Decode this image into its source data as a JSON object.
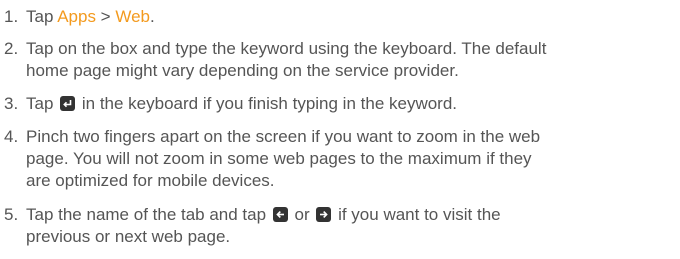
{
  "steps": [
    {
      "num": "1.",
      "prefix": "Tap ",
      "apps": "Apps",
      "sep": " > ",
      "web": "Web",
      "suffix": "."
    },
    {
      "num": "2.",
      "line1": "Tap on the box and type the keyword using the keyboard. The default",
      "line2": "home page might vary depending on the service provider."
    },
    {
      "num": "3.",
      "before": "Tap ",
      "icon": "enter-key-icon",
      "after": " in the keyboard if you finish typing in the keyword."
    },
    {
      "num": "4.",
      "line1": "Pinch two fingers apart on the screen if you want to zoom in the web",
      "line2": "page. You will not zoom in some web pages to the maximum if they",
      "line3": "are optimized for mobile devices."
    },
    {
      "num": "5.",
      "before": "Tap the name of the tab and tap ",
      "icon_back": "back-arrow-icon",
      "middle": " or ",
      "icon_forward": "forward-arrow-icon",
      "after": " if you want to visit the",
      "line2": "previous or next web page."
    }
  ],
  "colors": {
    "text": "#555555",
    "accent": "#f39a1e",
    "icon": "#333333"
  }
}
